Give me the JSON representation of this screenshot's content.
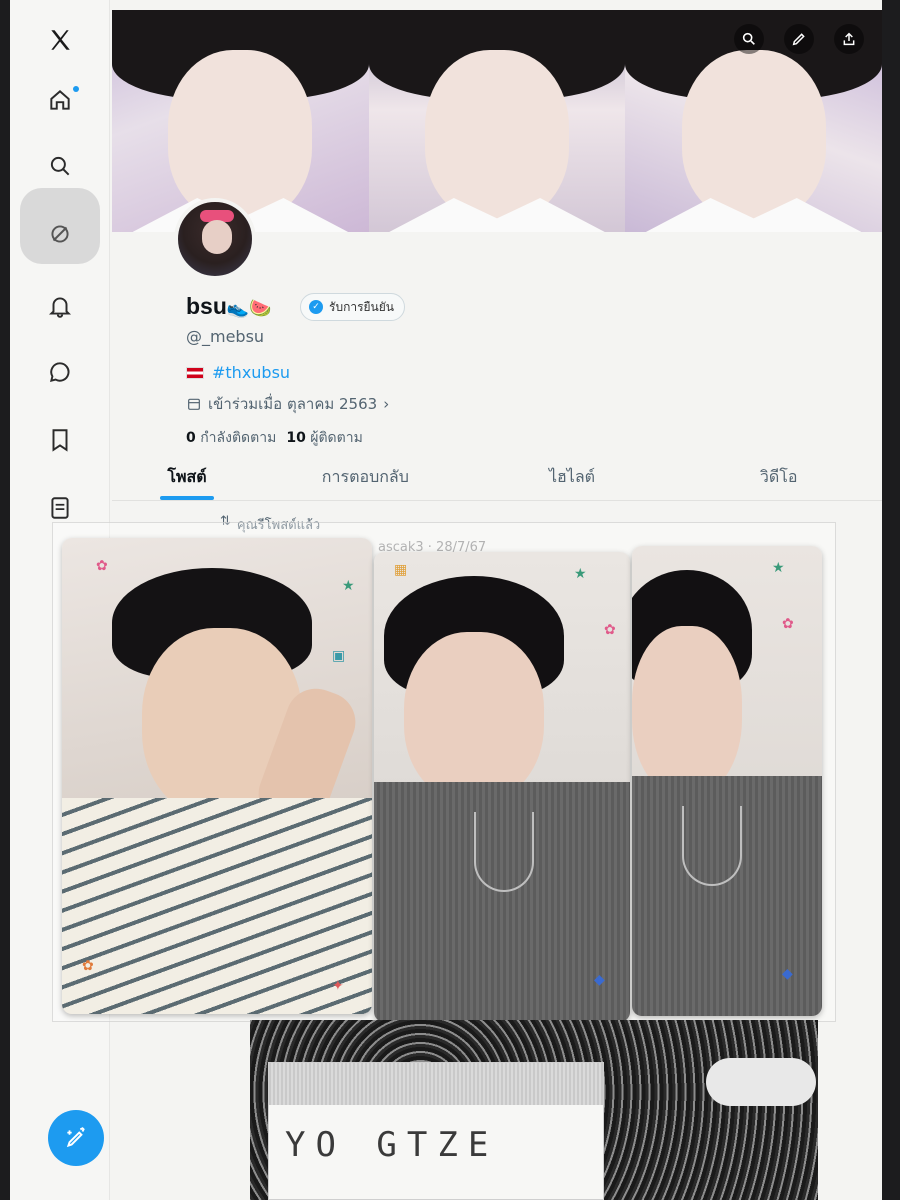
{
  "banner": {
    "actions": [
      "search-icon",
      "edit-icon",
      "share-icon"
    ]
  },
  "sidebar": {
    "items": [
      {
        "name": "x-logo-icon"
      },
      {
        "name": "home-icon"
      },
      {
        "name": "search-icon"
      },
      {
        "name": "grok-icon"
      },
      {
        "name": "notifications-icon"
      },
      {
        "name": "messages-icon"
      },
      {
        "name": "bookmarks-icon"
      },
      {
        "name": "lists-icon"
      }
    ],
    "compose_icon": "compose-post-icon"
  },
  "profile": {
    "display_name": "bsu",
    "name_emojis": "👟🍉",
    "verify_label": "รับการยืนยัน",
    "handle": "@_mebsu",
    "bio_tag": "#thxubsu",
    "joined": "เข้าร่วมเมื่อ ตุลาคม 2563",
    "following_count": "0",
    "following_label": "กำลังติดตาม",
    "followers_count": "10",
    "followers_label": "ผู้ติดตาม"
  },
  "tabs": [
    {
      "label": "โพสต์",
      "active": true
    },
    {
      "label": "การตอบกลับ",
      "active": false
    },
    {
      "label": "ไฮไลต์",
      "active": false
    },
    {
      "label": "วิดีโอ",
      "active": false
    }
  ],
  "post": {
    "repost_text": "คุณรีโพสต์แล้ว",
    "meta_text": "ascak3 · 28/7/67"
  },
  "overlay": {
    "handwritten_name": "YO GTZE"
  },
  "colors": {
    "accent": "#1d9bf0",
    "text_primary": "#0f1419",
    "text_secondary": "#536471"
  }
}
